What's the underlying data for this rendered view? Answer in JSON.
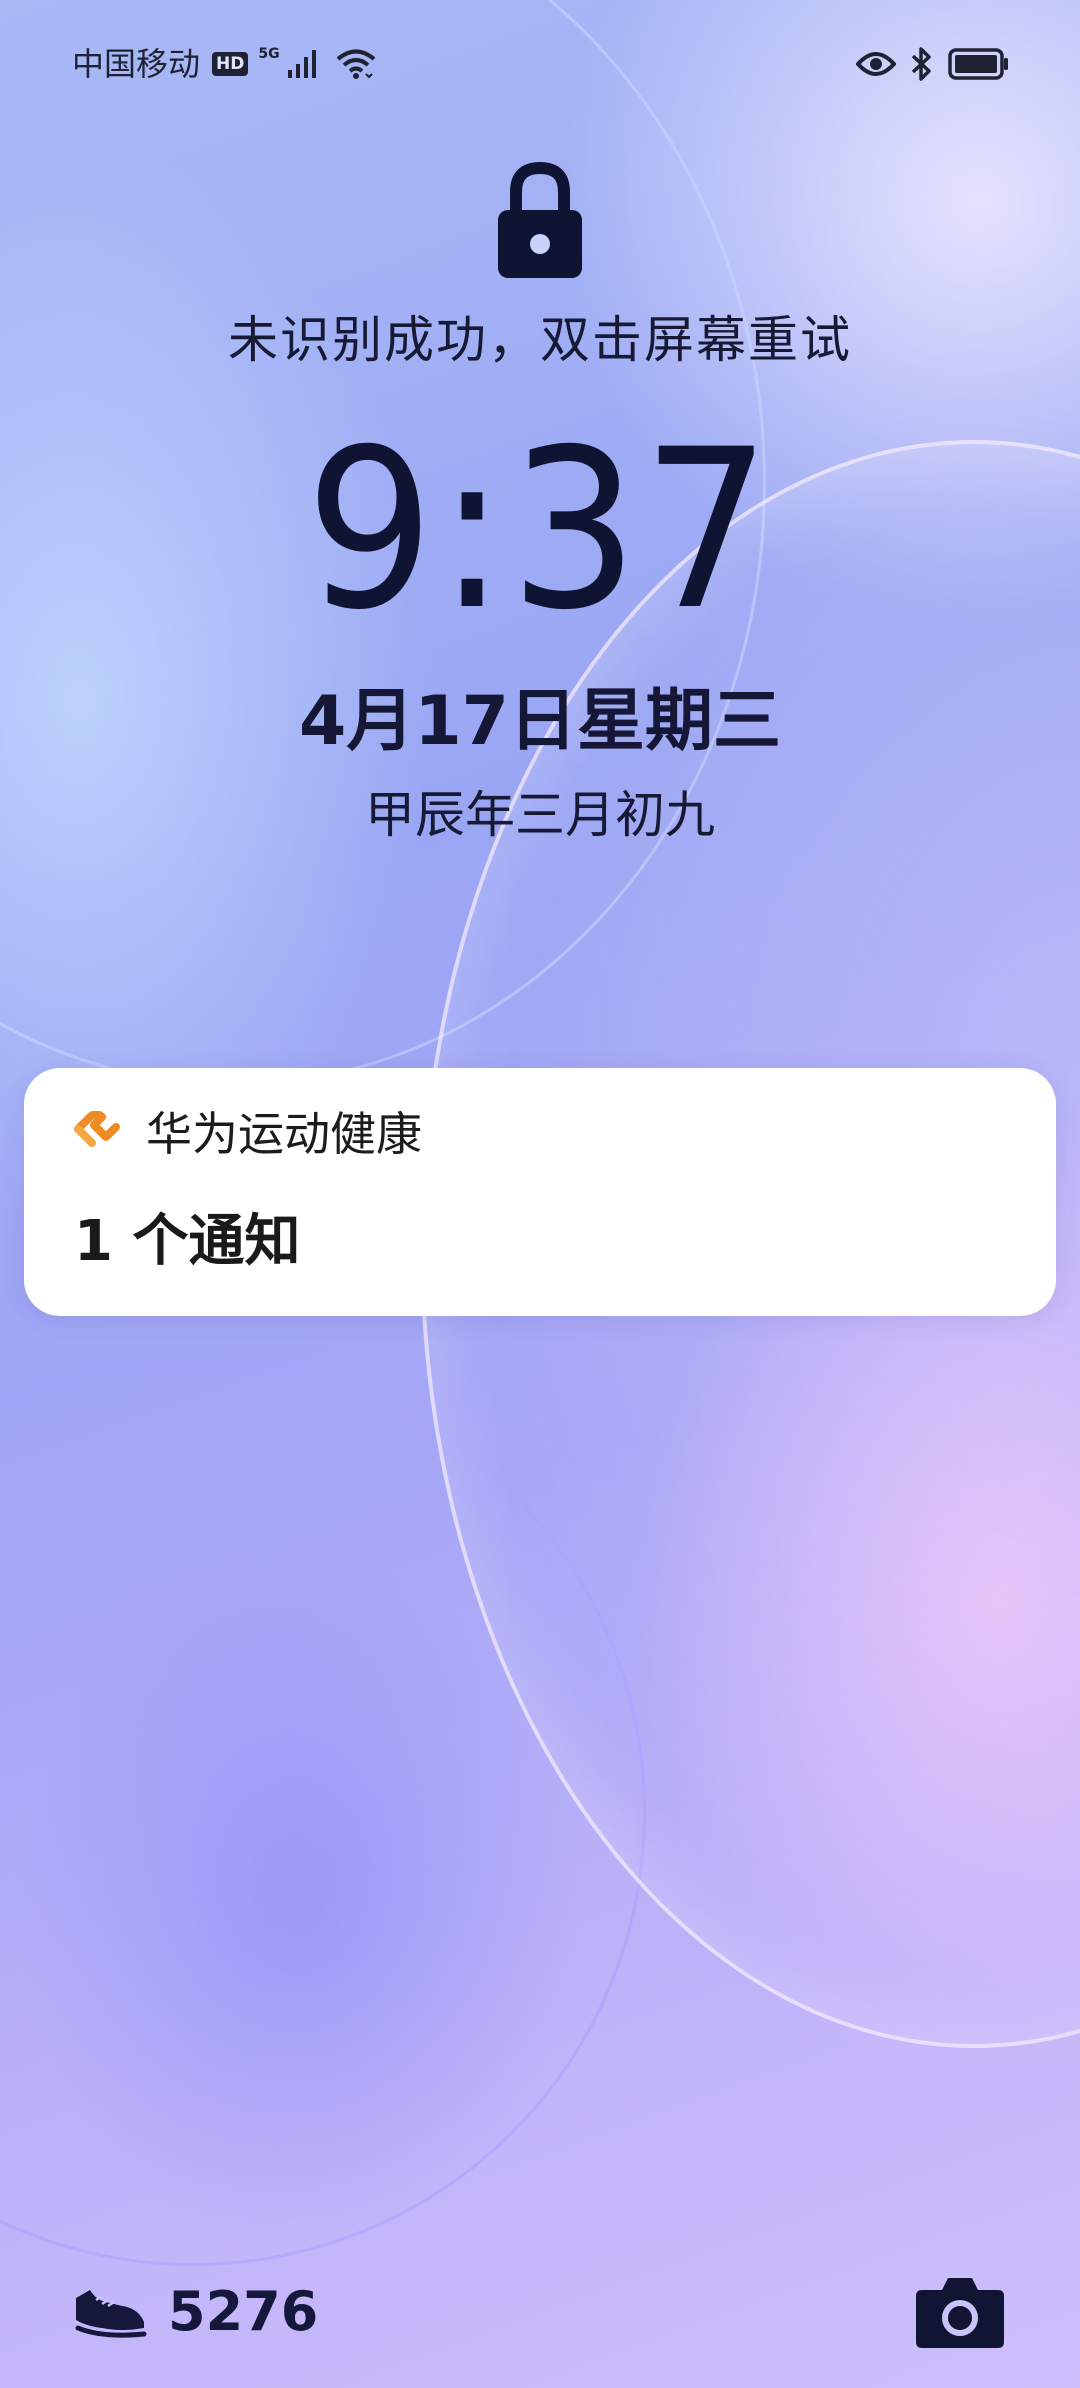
{
  "status_bar": {
    "carrier": "中国移动",
    "hd_badge": "HD",
    "network_type": "5G",
    "icons": [
      "signal-bars-icon",
      "wifi-icon",
      "eye-icon",
      "bluetooth-icon",
      "battery-icon"
    ]
  },
  "lock_screen": {
    "lock_icon": "lock-icon",
    "hint": "未识别成功，双击屏幕重试",
    "time": "9:37",
    "date": "4月17日星期三",
    "lunar_date": "甲辰年三月初九"
  },
  "notification": {
    "app_icon": "huawei-health-icon",
    "app_name": "华为运动健康",
    "summary": "1 个通知"
  },
  "bottom_bar": {
    "steps_icon": "sneaker-icon",
    "steps": "5276",
    "camera_icon": "camera-icon"
  },
  "colors": {
    "text_dark": "#0f1433",
    "health_accent": "#f08a24"
  }
}
